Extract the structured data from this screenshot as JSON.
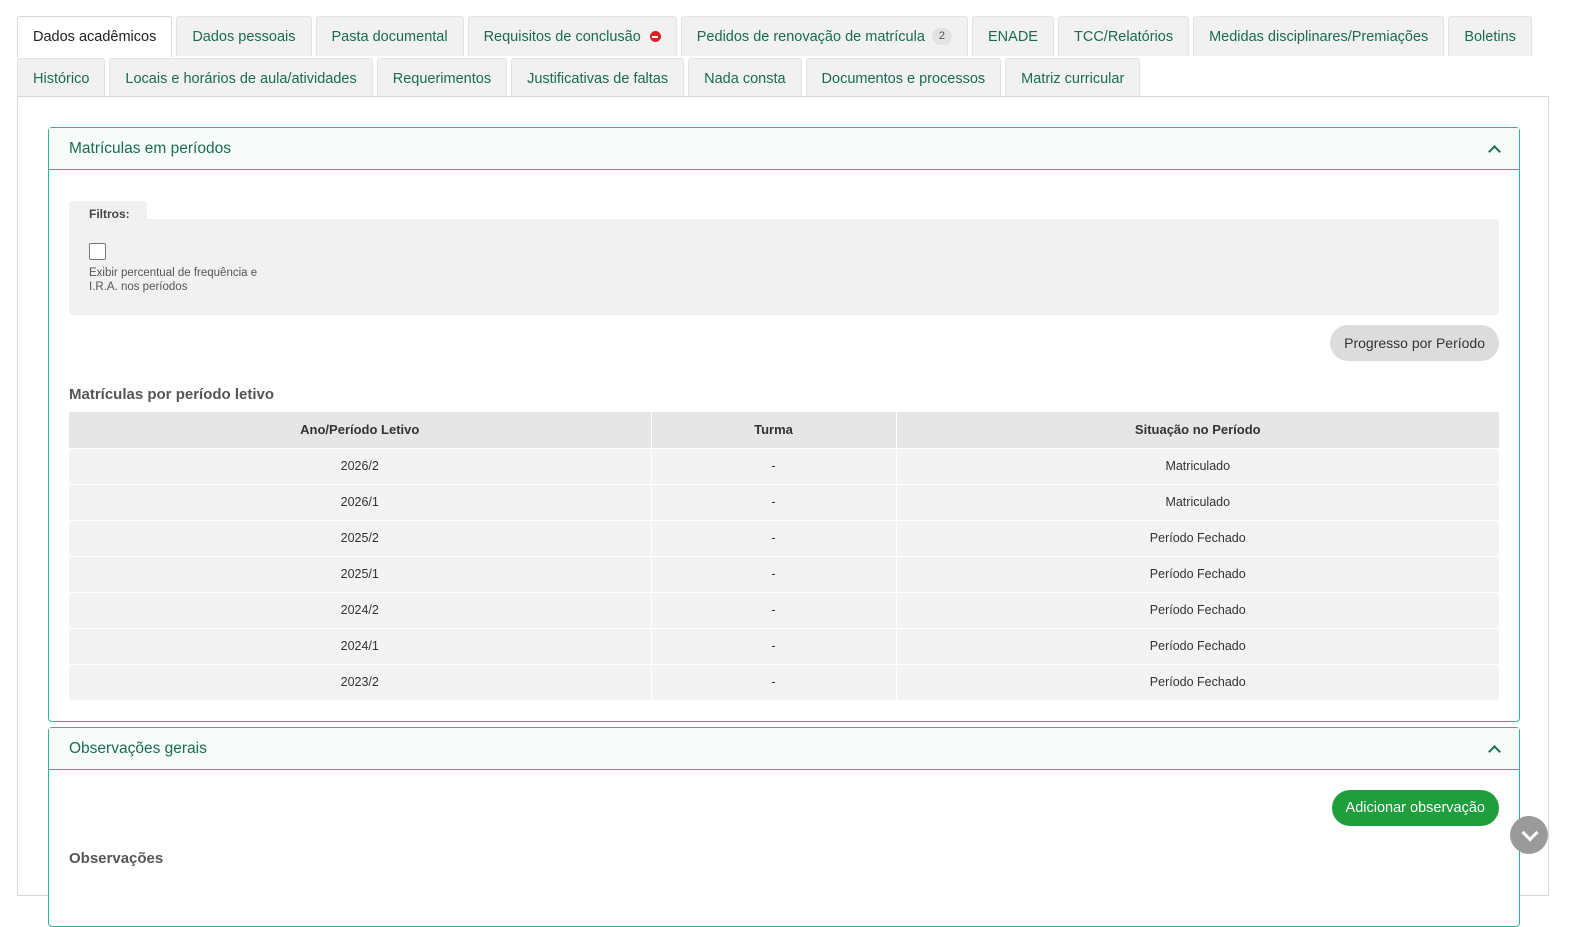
{
  "tabs": {
    "row1": [
      "Dados acadêmicos",
      "Dados pessoais",
      "Pasta documental",
      "Requisitos de conclusão",
      "Pedidos de renovação de matrícula",
      "ENADE",
      "TCC/Relatórios",
      "Medidas disciplinares/Premiações",
      "Boletins"
    ],
    "row2": [
      "Histórico",
      "Locais e horários de aula/atividades",
      "Requerimentos",
      "Justificativas de faltas",
      "Nada consta",
      "Documentos e processos",
      "Matriz curricular"
    ],
    "active": "Dados acadêmicos",
    "renewal_count": "2"
  },
  "enrollments_panel": {
    "title": "Matrículas em períodos",
    "filters_label": "Filtros:",
    "checkbox_label": "Exibir percentual de frequência e I.R.A. nos períodos",
    "progress_button": "Progresso por Período",
    "table_title": "Matrículas por período letivo",
    "columns": [
      "Ano/Período Letivo",
      "Turma",
      "Situação no Período"
    ],
    "rows": [
      [
        "2026/2",
        "-",
        "Matriculado"
      ],
      [
        "2026/1",
        "-",
        "Matriculado"
      ],
      [
        "2025/2",
        "-",
        "Período Fechado"
      ],
      [
        "2025/1",
        "-",
        "Período Fechado"
      ],
      [
        "2024/2",
        "-",
        "Período Fechado"
      ],
      [
        "2024/1",
        "-",
        "Período Fechado"
      ],
      [
        "2023/2",
        "-",
        "Período Fechado"
      ]
    ]
  },
  "observations_panel": {
    "title": "Observações gerais",
    "add_button": "Adicionar observação",
    "heading": "Observações"
  },
  "colors": {
    "accent": "#2bb494",
    "tab_text": "#1a6b52",
    "primary_button": "#1f9e3d",
    "remove_icon": "#d42424"
  }
}
